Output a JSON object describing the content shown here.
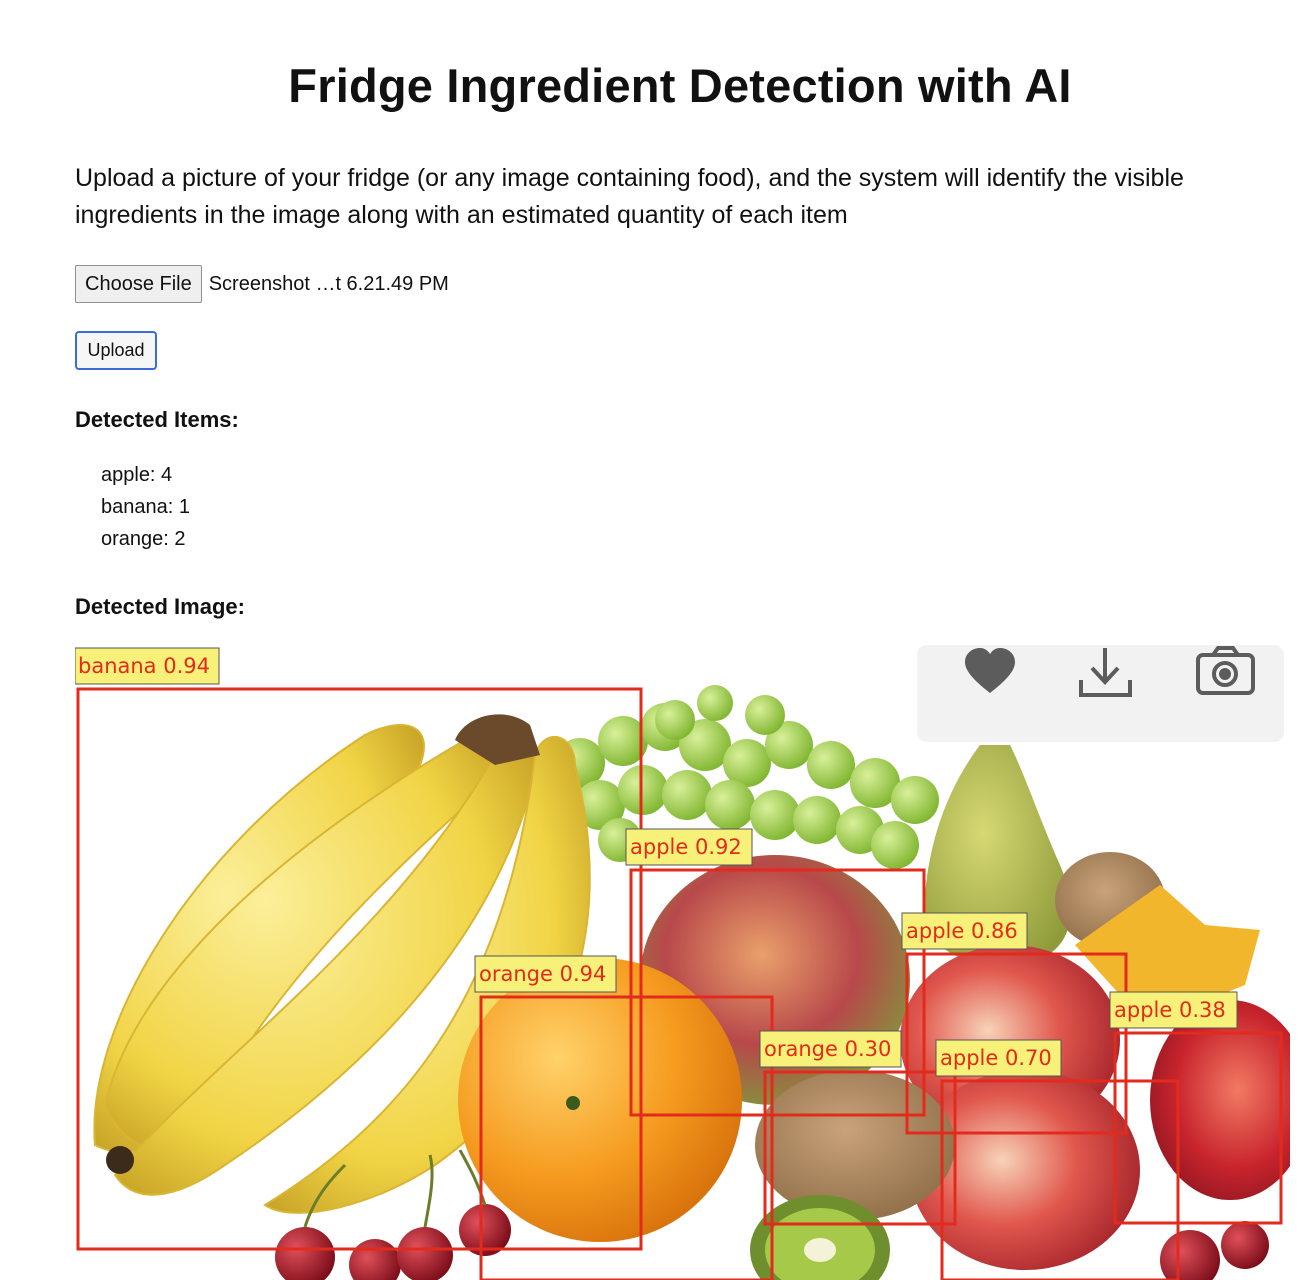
{
  "page": {
    "title": "Fridge Ingredient Detection with AI",
    "description": "Upload a picture of your fridge (or any image containing food), and the system will identify the visible ingredients in the image along with an estimated quantity of each item"
  },
  "upload_form": {
    "choose_file_label": "Choose File",
    "selected_file": "Screenshot …t 6.21.49 PM",
    "upload_label": "Upload"
  },
  "results": {
    "items_heading": "Detected Items:",
    "items": [
      {
        "label": "apple",
        "count": 4,
        "text": "apple: 4"
      },
      {
        "label": "banana",
        "count": 1,
        "text": "banana: 1"
      },
      {
        "label": "orange",
        "count": 2,
        "text": "orange: 2"
      }
    ],
    "image_heading": "Detected Image:"
  },
  "detections": [
    {
      "label": "banana",
      "score": 0.94,
      "text": "banana 0.94"
    },
    {
      "label": "apple",
      "score": 0.92,
      "text": "apple 0.92"
    },
    {
      "label": "apple",
      "score": 0.86,
      "text": "apple 0.86"
    },
    {
      "label": "orange",
      "score": 0.94,
      "text": "orange 0.94"
    },
    {
      "label": "apple",
      "score": 0.38,
      "text": "apple 0.38"
    },
    {
      "label": "orange",
      "score": 0.3,
      "text": "orange 0.30"
    },
    {
      "label": "apple",
      "score": 0.7,
      "text": "apple 0.70"
    }
  ],
  "image_toolbar": {
    "icons": [
      "heart-icon",
      "download-icon",
      "camera-icon"
    ]
  },
  "colors": {
    "box_stroke": "#e22b1c",
    "label_background": "#f7f17a",
    "upload_focus_border": "#3a6bd6"
  }
}
